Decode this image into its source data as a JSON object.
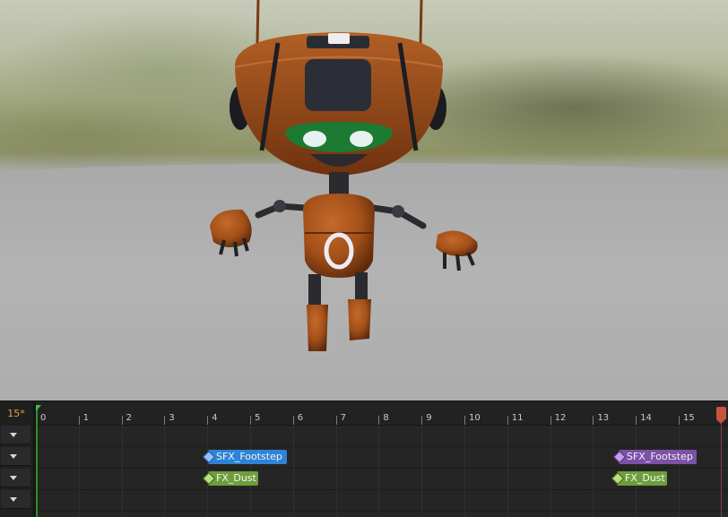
{
  "timeline": {
    "frame_counter": "15*",
    "ticks": [
      "0",
      "1",
      "2",
      "3",
      "4",
      "5",
      "6",
      "7",
      "8",
      "9",
      "10",
      "11",
      "12",
      "13",
      "14",
      "15"
    ],
    "notifies": [
      {
        "label": "SFX_Footstep",
        "color": "blue",
        "track": 1
      },
      {
        "label": "FX_Dust",
        "color": "green",
        "track": 2
      },
      {
        "label": "SFX_Footstep",
        "color": "purple",
        "track": 1
      },
      {
        "label": "FX_Dust",
        "color": "green",
        "track": 2
      }
    ]
  },
  "colors": {
    "frame_counter": "#e2a33a",
    "start_marker": "#3bbf3b",
    "end_marker": "#c8533e",
    "robot_body": "#a24f18"
  },
  "icons": {
    "track_collapse": "chevron-down-icon"
  }
}
